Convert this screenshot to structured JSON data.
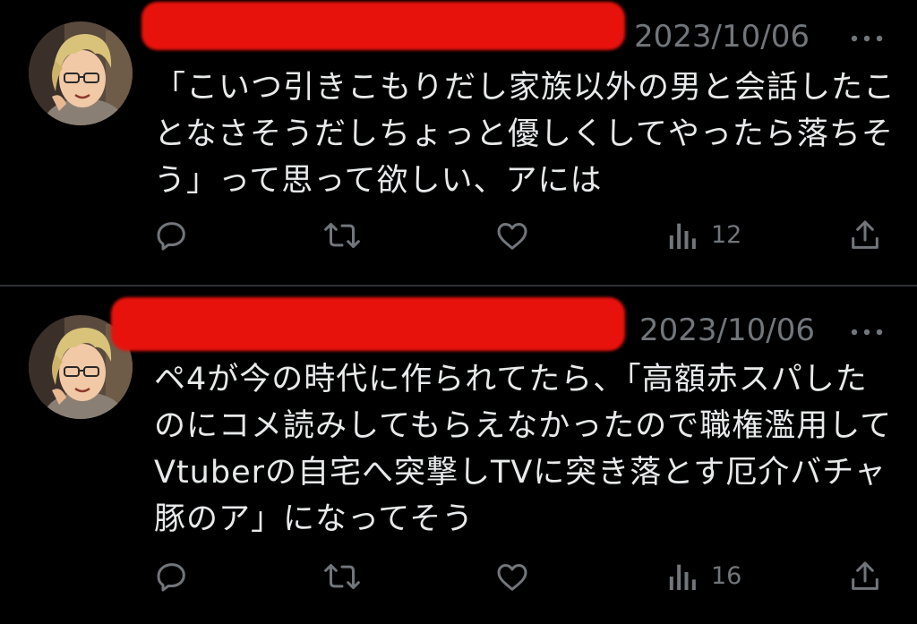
{
  "tweets": [
    {
      "date": "2023/10/06",
      "text": "「こいつ引きこもりだし家族以外の男と会話したことなさそうだしちょっと優しくしてやったら落ちそう」って思って欲しい、アには",
      "views": "12"
    },
    {
      "date": "2023/10/06",
      "text": "ペ4が今の時代に作られてたら、「高額赤スパしたのにコメ読みしてもらえなかったので職権濫用してVtuberの自宅へ突撃しTVに突き落とす厄介バチャ豚のア」になってそう",
      "views": "16"
    }
  ],
  "icons": {
    "reply": "reply-icon",
    "retweet": "retweet-icon",
    "like": "heart-icon",
    "views": "views-icon",
    "share": "share-icon",
    "more": "more-icon"
  },
  "colors": {
    "background": "#000000",
    "text": "#e7e9ea",
    "muted": "#71767b",
    "divider": "#2f3336",
    "redaction": "#e8120c"
  }
}
